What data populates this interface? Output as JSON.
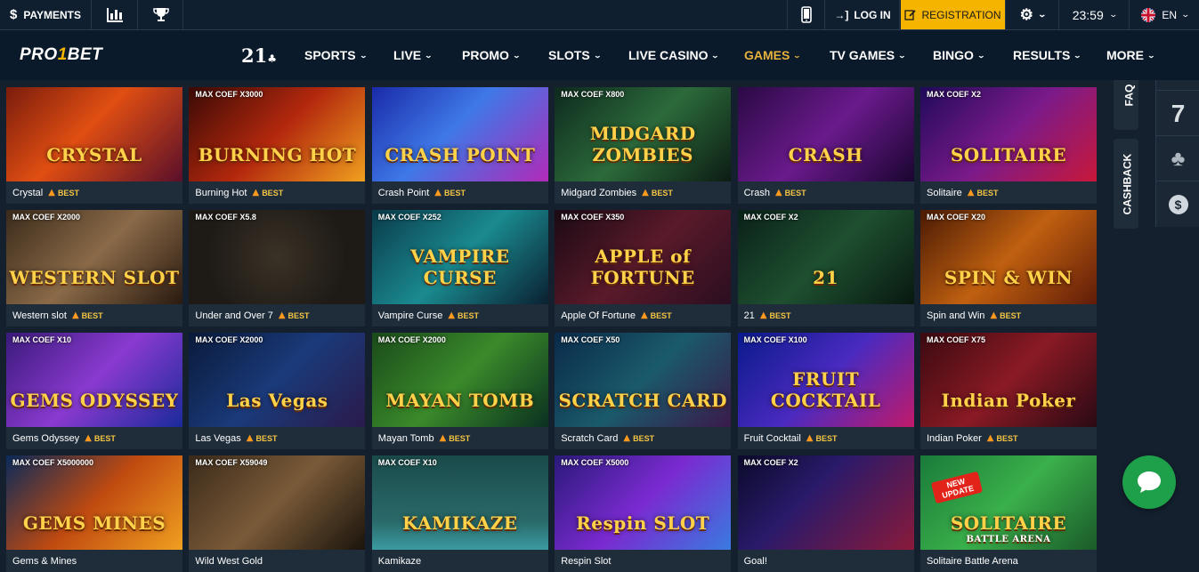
{
  "topbar": {
    "payments_label": "PAYMENTS",
    "login_label": "LOG IN",
    "registration_label": "REGISTRATION",
    "time": "23:59",
    "language": "EN"
  },
  "nav": {
    "logo_main": "PRO",
    "logo_accent": "1",
    "logo_end": "BET",
    "logo21": "21",
    "items": [
      {
        "label": "SPORTS"
      },
      {
        "label": "LIVE"
      },
      {
        "label": "PROMO"
      },
      {
        "label": "SLOTS"
      },
      {
        "label": "LIVE CASINO"
      },
      {
        "label": "GAMES"
      },
      {
        "label": "TV GAMES"
      },
      {
        "label": "BINGO"
      },
      {
        "label": "RESULTS"
      },
      {
        "label": "MORE"
      }
    ]
  },
  "best_label": "BEST",
  "games": [
    {
      "name": "Crystal",
      "badge": "",
      "art": "CRYSTAL",
      "best": true
    },
    {
      "name": "Burning Hot",
      "badge": "MAX COEF X3000",
      "art": "BURNING HOT",
      "best": true
    },
    {
      "name": "Crash Point",
      "badge": "",
      "art": "CRASH POINT",
      "best": true
    },
    {
      "name": "Midgard Zombies",
      "badge": "MAX COEF X800",
      "art": "MIDGARD ZOMBIES",
      "best": true
    },
    {
      "name": "Crash",
      "badge": "",
      "art": "CRASH",
      "best": true
    },
    {
      "name": "Solitaire",
      "badge": "MAX COEF X2",
      "art": "SOLITAIRE",
      "best": true
    },
    {
      "name": "Western slot",
      "badge": "MAX COEF X2000",
      "art": "WESTERN SLOT",
      "best": true
    },
    {
      "name": "Under and Over 7",
      "badge": "MAX COEF X5.8",
      "art": "",
      "best": true
    },
    {
      "name": "Vampire Curse",
      "badge": "MAX COEF X252",
      "art": "VAMPIRE CURSE",
      "best": true
    },
    {
      "name": "Apple Of Fortune",
      "badge": "MAX COEF X350",
      "art": "APPLE of FORTUNE",
      "best": true
    },
    {
      "name": "21",
      "badge": "MAX COEF X2",
      "art": "21",
      "best": true
    },
    {
      "name": "Spin and Win",
      "badge": "MAX COEF X20",
      "art": "SPIN & WIN",
      "best": true
    },
    {
      "name": "Gems Odyssey",
      "badge": "MAX COEF X10",
      "art": "GEMS ODYSSEY",
      "best": true
    },
    {
      "name": "Las Vegas",
      "badge": "MAX COEF X2000",
      "art": "Las Vegas",
      "best": true
    },
    {
      "name": "Mayan Tomb",
      "badge": "MAX COEF X2000",
      "art": "MAYAN TOMB",
      "best": true
    },
    {
      "name": "Scratch Card",
      "badge": "MAX COEF X50",
      "art": "SCRATCH CARD",
      "best": true
    },
    {
      "name": "Fruit Cocktail",
      "badge": "MAX COEF X100",
      "art": "FRUIT COCKTAIL",
      "best": true
    },
    {
      "name": "Indian Poker",
      "badge": "MAX COEF X75",
      "art": "Indian Poker",
      "best": true
    },
    {
      "name": "Gems & Mines",
      "badge": "MAX COEF X5000000",
      "art": "GEMS MINES",
      "best": false
    },
    {
      "name": "Wild West Gold",
      "badge": "MAX COEF X59049",
      "art": "",
      "best": false
    },
    {
      "name": "Kamikaze",
      "badge": "MAX COEF X10",
      "art": "KAMIKAZE",
      "best": false
    },
    {
      "name": "Respin Slot",
      "badge": "MAX COEF X5000",
      "art": "Respin SLOT",
      "best": false
    },
    {
      "name": "Goal!",
      "badge": "MAX COEF X2",
      "art": "",
      "best": false
    },
    {
      "name": "Solitaire Battle Arena",
      "badge": "",
      "art": "SOLITAIRE",
      "art_sub": "BATTLE ARENA",
      "art_corner": "NEW UPDATE",
      "best": false
    }
  ],
  "side": {
    "faq_label": "FAQ",
    "cashback_label": "CASHBACK",
    "seven": "7"
  }
}
